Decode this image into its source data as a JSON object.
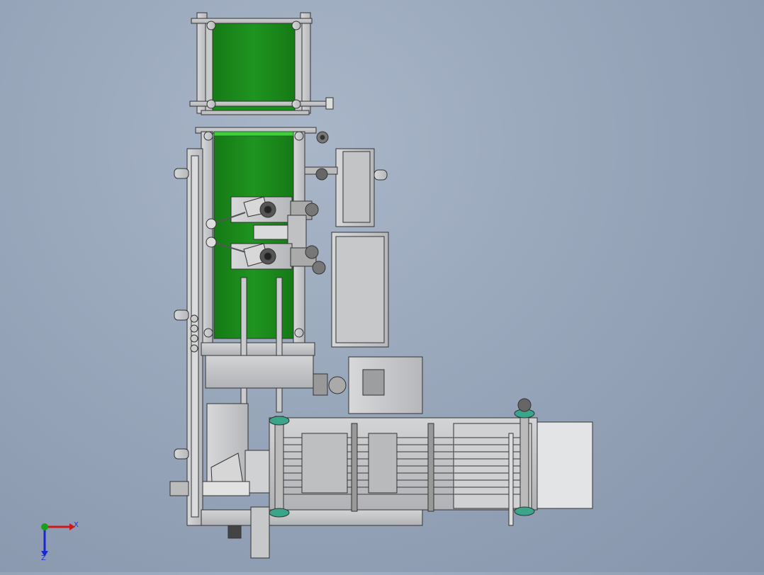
{
  "viewport": {
    "background_top": "#a9b6c8",
    "background_bottom": "#8594ab"
  },
  "colors": {
    "belt": "#1e8a1e",
    "belt_highlight": "#3fcf3f",
    "frame": "#c4c6c8",
    "frame_edge": "#3a3a3a",
    "shaft_green": "#3aa58a",
    "triad_x": "#d01818",
    "triad_y": "#18a018",
    "triad_z": "#1828d0"
  },
  "triad": {
    "x_label": "X",
    "z_label": "Z",
    "icon": "coordinate-triad-icon"
  }
}
